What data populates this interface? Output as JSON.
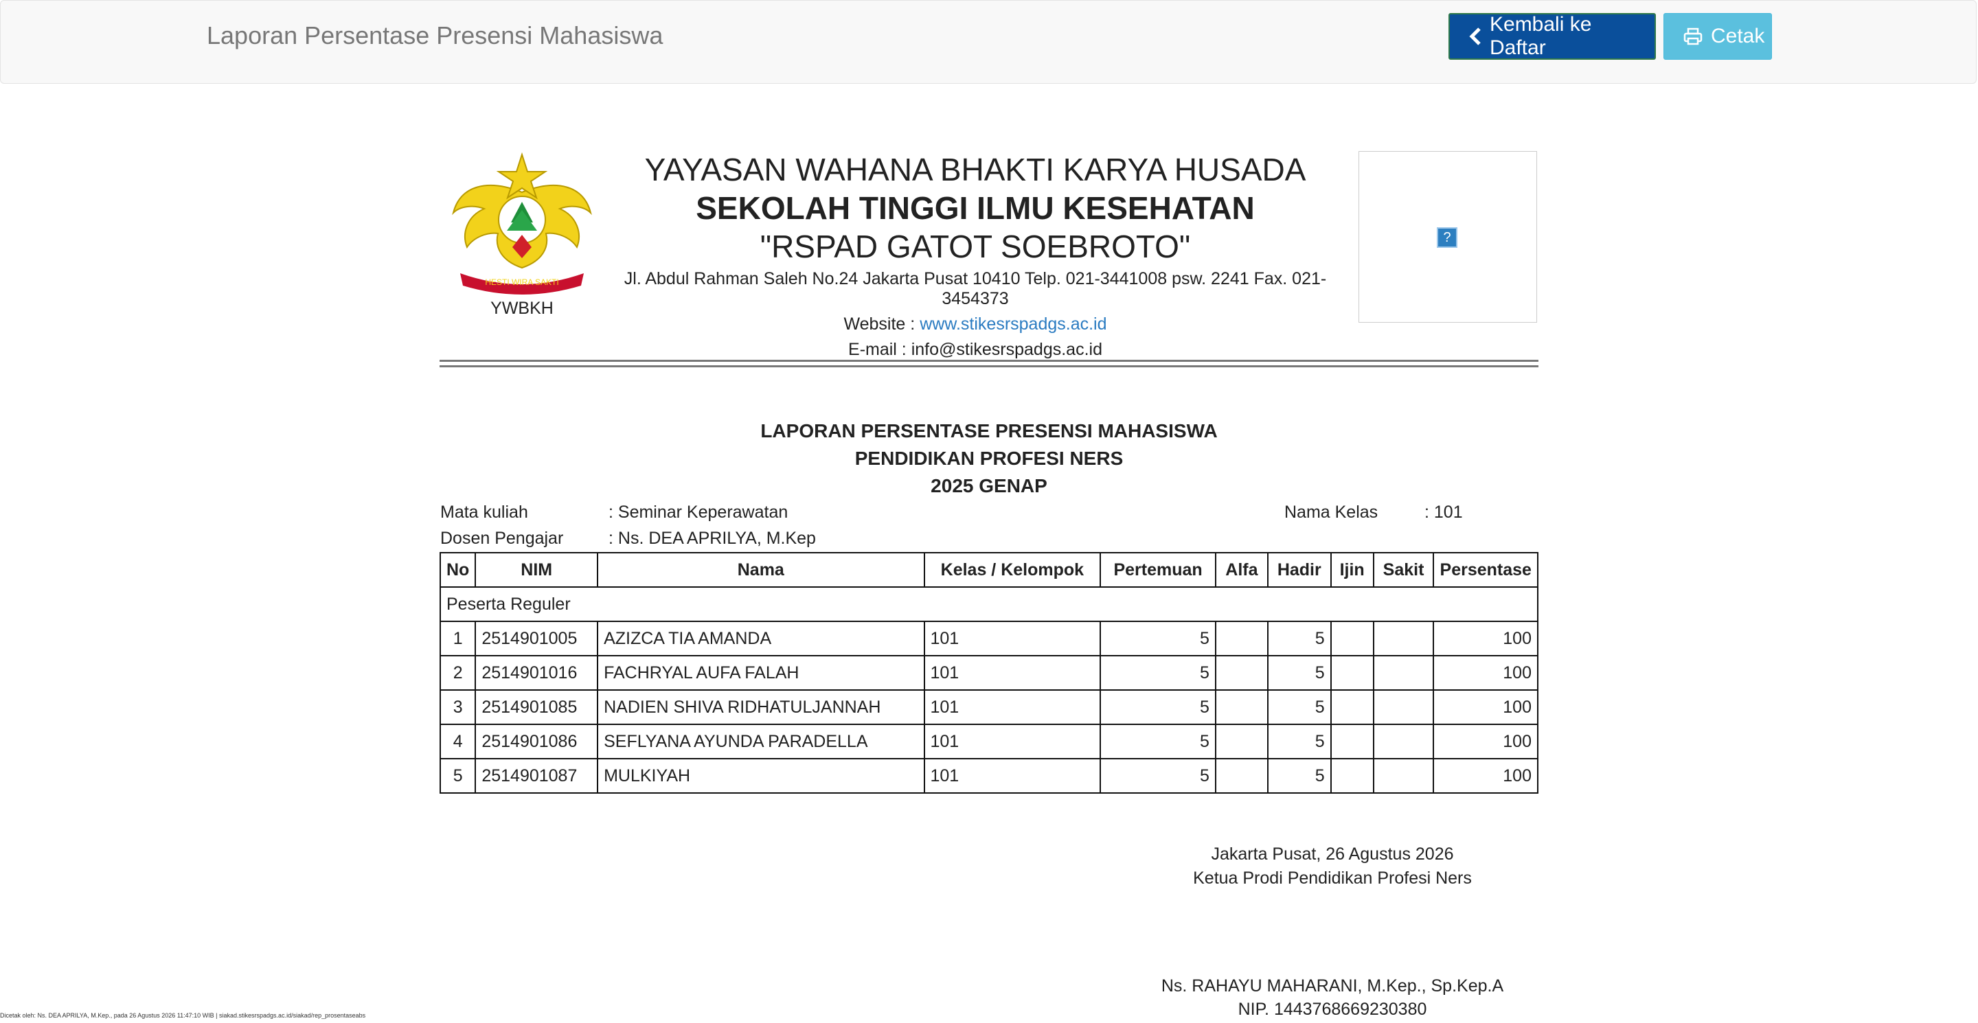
{
  "topbar": {
    "title": "Laporan Persentase Presensi Mahasiswa",
    "back_label": "Kembali ke Daftar",
    "print_label": "Cetak"
  },
  "header": {
    "logo_caption": "YWBKH",
    "logo_ribbon": "HESTI WIRA SAKTI",
    "line1": "YAYASAN WAHANA BHAKTI KARYA HUSADA",
    "line2": "SEKOLAH TINGGI ILMU KESEHATAN",
    "line3": "\"RSPAD GATOT SOEBROTO\"",
    "address": "Jl. Abdul Rahman Saleh No.24 Jakarta Pusat 10410 Telp. 021-3441008 psw. 2241 Fax. 021-3454373",
    "website_label": "Website : ",
    "website": "www.stikesrspadgs.ac.id",
    "email": "E-mail : info@stikesrspadgs.ac.id",
    "photo_placeholder": "?"
  },
  "report": {
    "title1": "LAPORAN PERSENTASE PRESENSI MAHASISWA",
    "title2": "PENDIDIKAN PROFESI NERS",
    "title3": "2025 GENAP",
    "mk_label": "Mata kuliah",
    "mk_value": ": Seminar Keperawatan",
    "dosen_label": "Dosen Pengajar",
    "dosen_value": ": Ns. DEA APRILYA, M.Kep",
    "kelas_label": "Nama Kelas",
    "kelas_value": ": 101"
  },
  "table": {
    "headers": [
      "No",
      "NIM",
      "Nama",
      "Kelas / Kelompok",
      "Pertemuan",
      "Alfa",
      "Hadir",
      "Ijin",
      "Sakit",
      "Persentase"
    ],
    "group": "Peserta Reguler",
    "rows": [
      [
        "1",
        "2514901005",
        "AZIZCA TIA AMANDA",
        "101",
        "5",
        "",
        "5",
        "",
        "",
        "100"
      ],
      [
        "2",
        "2514901016",
        "FACHRYAL AUFA FALAH",
        "101",
        "5",
        "",
        "5",
        "",
        "",
        "100"
      ],
      [
        "3",
        "2514901085",
        "NADIEN SHIVA RIDHATULJANNAH",
        "101",
        "5",
        "",
        "5",
        "",
        "",
        "100"
      ],
      [
        "4",
        "2514901086",
        "SEFLYANA AYUNDA PARADELLA",
        "101",
        "5",
        "",
        "5",
        "",
        "",
        "100"
      ],
      [
        "5",
        "2514901087",
        "MULKIYAH",
        "101",
        "5",
        "",
        "5",
        "",
        "",
        "100"
      ]
    ]
  },
  "signature": {
    "place_date": "Jakarta Pusat, 26 Agustus 2026",
    "role": "Ketua Prodi Pendidikan Profesi Ners",
    "name": "Ns. RAHAYU MAHARANI, M.Kep., Sp.Kep.A",
    "nip": "NIP. 1443768669230380"
  },
  "footer": {
    "note": "Dicetak oleh: Ns. DEA APRILYA, M.Kep., pada 26 Agustus 2026 11:47:10 WIB | siakad.stikesrspadgs.ac.id/siakad/rep_prosentaseabs"
  },
  "colors": {
    "back_button": "#0a4f9b",
    "print_button": "#5bc0de",
    "link": "#2a7bc1"
  }
}
